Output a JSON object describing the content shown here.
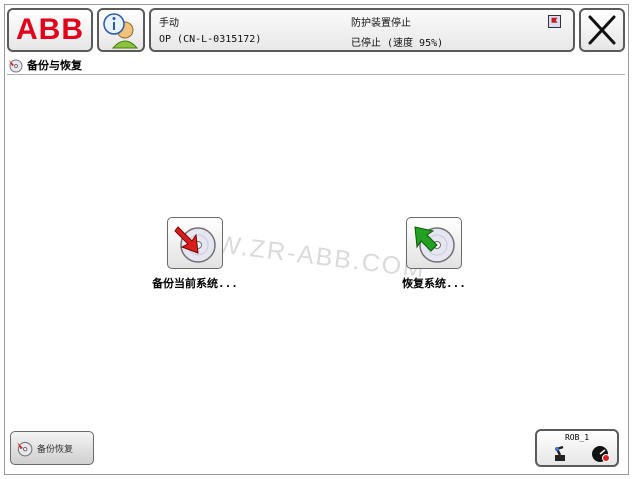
{
  "header": {
    "logo": "ABB",
    "status": {
      "mode": "手动",
      "controller": "OP (CN-L-0315172)",
      "safety": "防护装置停止",
      "state": "已停止 (速度 95%)"
    }
  },
  "page": {
    "title": "备份与恢复"
  },
  "actions": {
    "backup_label": "备份当前系统...",
    "restore_label": "恢复系统..."
  },
  "watermark": "WWW.ZR-ABB.COM",
  "taskbar": {
    "active_app_label": "备份恢复"
  },
  "robot": {
    "name": "ROB_1"
  },
  "colors": {
    "brand_red": "#e2001a",
    "backup_arrow": "#d81e1e",
    "restore_arrow": "#22a022"
  },
  "icons": [
    "user-icon",
    "status-flag-icon",
    "close-icon",
    "backup-restore-icon",
    "backup-icon",
    "restore-icon",
    "robot-icon",
    "speed-icon"
  ]
}
